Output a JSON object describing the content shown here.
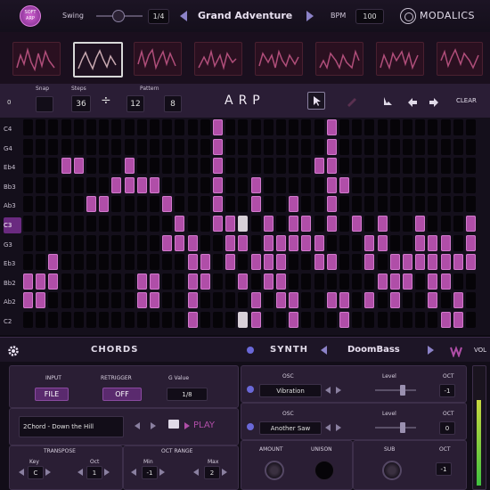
{
  "header": {
    "logo_text": "SOFT ARP",
    "swing_label": "Swing",
    "swing_value": "1/4",
    "preset_name": "Grand Adventure",
    "bpm_label": "BPM",
    "bpm_value": "100",
    "brand": "MODALICS"
  },
  "toolbar": {
    "zero": "0",
    "snap_label": "Snap",
    "steps_label": "Steps",
    "steps_value": "36",
    "division": "÷",
    "pattern_label": "Pattern",
    "pattern_a": "12",
    "pattern_b": "8",
    "title": "ARP",
    "clear_label": "CLEAR"
  },
  "rows": [
    "C4",
    "G4",
    "Eb4",
    "Bb3",
    "Ab3",
    "C3",
    "G3",
    "Eb3",
    "Bb2",
    "Ab2",
    "C2"
  ],
  "highlighted_row": "C3",
  "chords_bar": {
    "chords_label": "CHORDS",
    "synth_label": "SYNTH",
    "synth_preset": "DoomBass",
    "vol_label": "VOL"
  },
  "chords_panel": {
    "input_label": "INPUT",
    "input_value": "FILE",
    "retrigger_label": "RETRIGGER",
    "retrigger_value": "OFF",
    "gvalue_label": "G Value",
    "gvalue_value": "1/8",
    "chord_file": "2Chord - Down the Hill",
    "play_label": "PLAY",
    "transpose_label": "TRANSPOSE",
    "key_label": "Key",
    "key_value": "C",
    "oct_label": "Oct",
    "oct_value": "1",
    "oct_range_label": "OCT RANGE",
    "min_label": "Min",
    "min_value": "-1",
    "max_label": "Max",
    "max_value": "2"
  },
  "synth_panel": {
    "osc1_label": "OSC",
    "osc1_value": "Vibration",
    "level1_label": "Level",
    "oct1_label": "OCT",
    "oct1_value": "-1",
    "osc2_label": "OSC",
    "osc2_value": "Another Saw",
    "level2_label": "Level",
    "oct2_label": "OCT",
    "oct2_value": "0",
    "amount_label": "AMOUNT",
    "unison_label": "UNISON",
    "sub_label": "SUB",
    "oct3_label": "OCT",
    "oct3_value": "-1"
  },
  "colors": {
    "accent": "#b04ea8",
    "panel": "#2a1e34",
    "background": "#0d0a12"
  }
}
